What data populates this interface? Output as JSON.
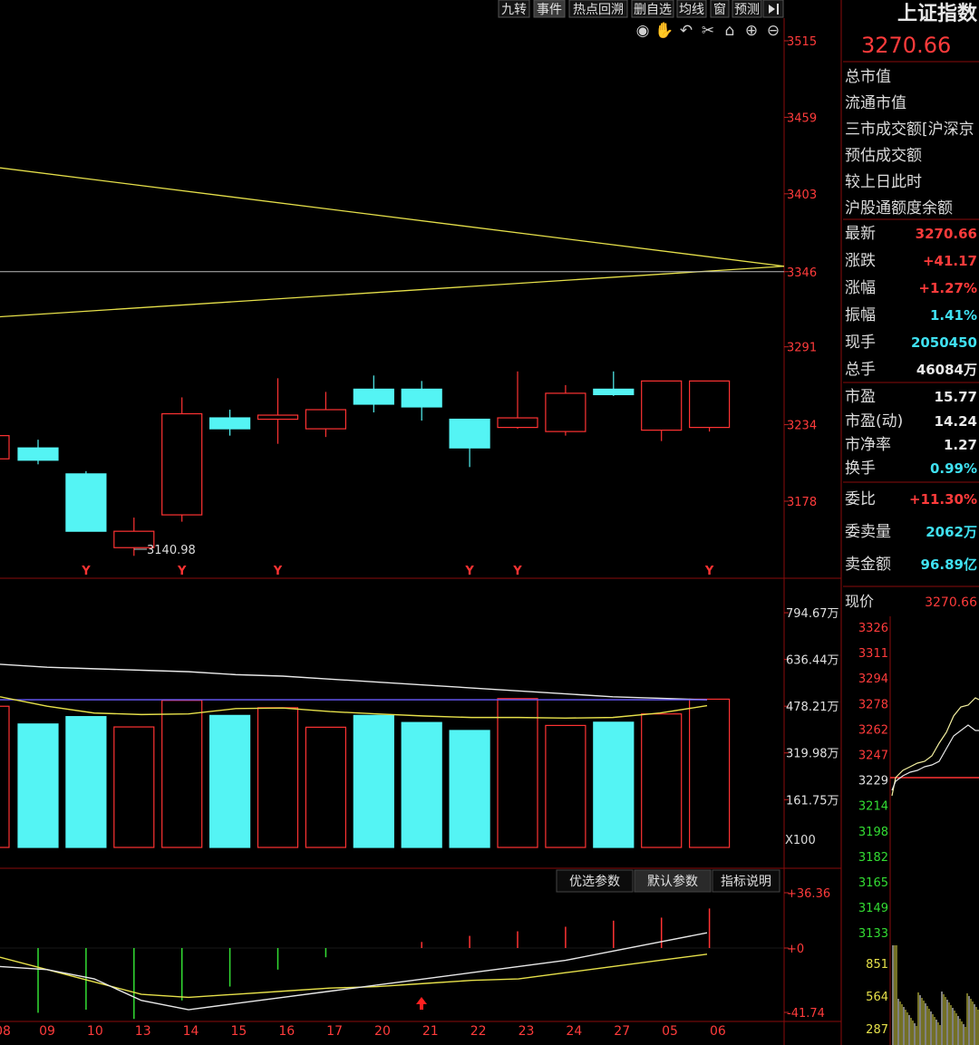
{
  "toolbar": {
    "items": [
      "九转",
      "事件",
      "热点回溯",
      "删自选",
      "均线",
      "窗",
      "预测"
    ],
    "active_index": 1
  },
  "chart_tools": [
    "eye-icon",
    "hand-icon",
    "undo-icon",
    "scissors-icon",
    "lock-icon",
    "zoom-in-icon",
    "zoom-out-icon"
  ],
  "panel": {
    "title": "上证指数",
    "price": "3270.66",
    "info_labels": [
      "总市值",
      "流通市值",
      "三市成交额[沪深京",
      "预估成交额",
      "较上日此时",
      "沪股通额度余额"
    ],
    "quote": [
      {
        "label": "最新",
        "value": "3270.66",
        "color": "#ff3b3b"
      },
      {
        "label": "涨跌",
        "value": "+41.17",
        "color": "#ff3b3b"
      },
      {
        "label": "涨幅",
        "value": "+1.27%",
        "color": "#ff3b3b"
      },
      {
        "label": "振幅",
        "value": "1.41%",
        "color": "#3fe0f0"
      },
      {
        "label": "现手",
        "value": "2050450",
        "color": "#3fe0f0"
      },
      {
        "label": "总手",
        "value": "46084万",
        "color": "#e8e8e8"
      },
      {
        "label": "市盈",
        "value": "15.77",
        "color": "#e8e8e8"
      },
      {
        "label": "市盈(动)",
        "value": "14.24",
        "color": "#e8e8e8"
      },
      {
        "label": "市净率",
        "value": "1.27",
        "color": "#e8e8e8"
      },
      {
        "label": "换手",
        "value": "0.99%",
        "color": "#3fe0f0"
      },
      {
        "label": "委比",
        "value": "+11.30%",
        "color": "#ff3b3b"
      },
      {
        "label": "委卖量",
        "value": "2062万",
        "color": "#3fe0f0"
      },
      {
        "label": "卖金额",
        "value": "96.89亿",
        "color": "#3fe0f0"
      }
    ],
    "mini": {
      "label": "现价",
      "value": "3270.66",
      "price_ticks": [
        "3326",
        "3311",
        "3294",
        "3278",
        "3262",
        "3247",
        "3229",
        "3214",
        "3198",
        "3182",
        "3165",
        "3149",
        "3133"
      ],
      "vol_ticks": [
        "851",
        "564",
        "287"
      ]
    }
  },
  "tabs": {
    "items": [
      "优选参数",
      "默认参数",
      "指标说明"
    ],
    "active_index": 1
  },
  "chart_data": {
    "type": "candlestick",
    "x_labels": [
      "08",
      "09",
      "10",
      "13",
      "14",
      "15",
      "16",
      "17",
      "20",
      "21",
      "22",
      "23",
      "24",
      "27",
      "05",
      "06"
    ],
    "price_axis": {
      "range": [
        3125,
        3525
      ],
      "ticks": [
        3515,
        3459,
        3403,
        3346,
        3291,
        3234,
        3178
      ]
    },
    "candles": [
      {
        "o": 3217,
        "h": 3223,
        "l": 3205,
        "c": 3208
      },
      {
        "o": 3198,
        "h": 3200,
        "l": 3168,
        "c": 3156
      },
      {
        "o": 3144,
        "h": 3166,
        "l": 3138,
        "c": 3156
      },
      {
        "o": 3168,
        "h": 3254,
        "l": 3163,
        "c": 3242
      },
      {
        "o": 3239,
        "h": 3245,
        "l": 3226,
        "c": 3231
      },
      {
        "o": 3238,
        "h": 3268,
        "l": 3220,
        "c": 3241
      },
      {
        "o": 3231,
        "h": 3258,
        "l": 3225,
        "c": 3245
      },
      {
        "o": 3260,
        "h": 3270,
        "l": 3243,
        "c": 3249
      },
      {
        "o": 3260,
        "h": 3266,
        "l": 3237,
        "c": 3247
      },
      {
        "o": 3238,
        "h": 3238,
        "l": 3203,
        "c": 3217
      },
      {
        "o": 3232,
        "h": 3273,
        "l": 3231,
        "c": 3239
      },
      {
        "o": 3229,
        "h": 3263,
        "l": 3226,
        "c": 3257
      },
      {
        "o": 3260,
        "h": 3273,
        "l": 3255,
        "c": 3256
      },
      {
        "o": 3230,
        "h": 3266,
        "l": 3222,
        "c": 3266
      },
      {
        "o": 3232,
        "h": 3266,
        "l": 3229,
        "c": 3266
      }
    ],
    "low_annotation": "3140.98",
    "markers": [
      {
        "index": 0,
        "label": "Y"
      },
      {
        "index": 2,
        "label": "Y"
      },
      {
        "index": 4,
        "label": "Y"
      },
      {
        "index": 8,
        "label": "Y"
      },
      {
        "index": 9,
        "label": "Y"
      },
      {
        "index": 14,
        "label": "Y"
      }
    ],
    "trend_lines": {
      "upper": [
        3422,
        3350
      ],
      "lower": [
        3313,
        3350
      ],
      "flat": 3346
    },
    "volume": {
      "unit": "X100",
      "ticks": [
        "794.67万",
        "636.44万",
        "478.21万",
        "319.98万",
        "161.75万"
      ],
      "tick_values": [
        794.67,
        636.44,
        478.21,
        319.98,
        161.75
      ],
      "range": [
        0,
        890
      ],
      "values": [
        418,
        443,
        408,
        498,
        447,
        473,
        407,
        447,
        423,
        396,
        504,
        413,
        424,
        452,
        502
      ],
      "ma_yellow": [
        510,
        478,
        455,
        450,
        452,
        470,
        472,
        460,
        452,
        445,
        440,
        440,
        438,
        440,
        455,
        480
      ],
      "ma_white": [
        620,
        610,
        605,
        600,
        595,
        585,
        580,
        570,
        560,
        550,
        540,
        530,
        520,
        510,
        505,
        500
      ],
      "ma_blue": [
        500,
        500,
        500,
        500,
        500,
        500,
        500,
        500,
        500,
        500,
        500,
        500,
        500,
        500,
        500,
        500
      ]
    },
    "macd": {
      "ticks": [
        "+36.36",
        "+0",
        "-41.74"
      ],
      "range": [
        -44,
        40
      ],
      "hist": [
        -20,
        -42,
        -40,
        -46,
        -34,
        -25,
        -14,
        -6,
        0,
        4,
        8,
        11,
        14,
        18,
        20,
        26
      ],
      "dif": [
        -6,
        -14,
        -22,
        -30,
        -32,
        -30,
        -28,
        -26,
        -25,
        -23,
        -21,
        -20,
        -16,
        -12,
        -8,
        -4
      ],
      "dea": [
        -12,
        -14,
        -20,
        -34,
        -40,
        -36,
        -32,
        -28,
        -24,
        -20,
        -16,
        -12,
        -8,
        -2,
        4,
        10
      ]
    }
  }
}
